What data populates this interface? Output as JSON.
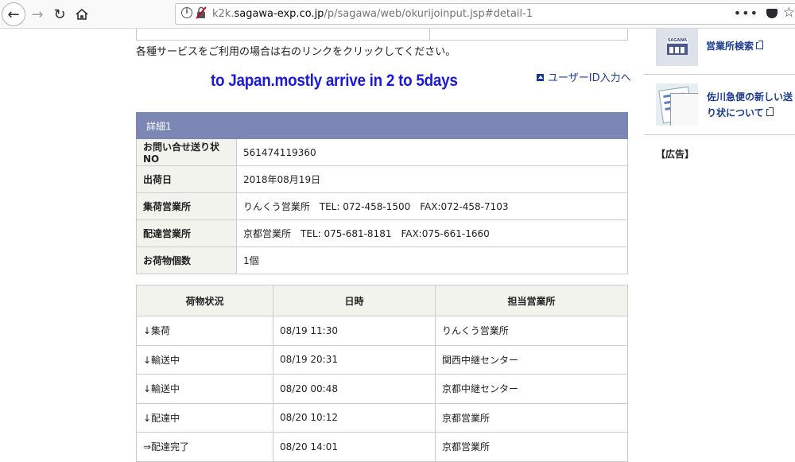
{
  "browser": {
    "url_prefix": "k2k.",
    "url_domain": "sagawa-exp.co.jp",
    "url_path": "/p/sagawa/web/okurijoinput.jsp#detail-1",
    "more": "•••"
  },
  "page": {
    "intro_text": "各種サービスをご利用の場合は右のリンクをクリックしてください。",
    "banner_text": "to Japan.mostly arrive in 2 to 5days",
    "userid_link": "ユーザーID入力へ"
  },
  "detail": {
    "header": "詳細1",
    "rows": [
      {
        "label": "お問い合せ送り状NO",
        "value": "561474119360"
      },
      {
        "label": "出荷日",
        "value": "2018年08月19日"
      },
      {
        "label": "集荷営業所",
        "value": "りんくう営業所　TEL: 072-458-1500　FAX:072-458-7103"
      },
      {
        "label": "配達営業所",
        "value": "京都営業所　TEL: 075-681-8181　FAX:075-661-1660"
      },
      {
        "label": "お荷物個数",
        "value": "1個"
      }
    ]
  },
  "status": {
    "columns": [
      "荷物状況",
      "日時",
      "担当営業所"
    ],
    "rows": [
      {
        "state": "↓集荷",
        "time": "08/19 11:30",
        "office": "りんくう営業所"
      },
      {
        "state": "↓輸送中",
        "time": "08/19 20:31",
        "office": "関西中継センター"
      },
      {
        "state": "↓輸送中",
        "time": "08/20 00:48",
        "office": "京都中継センター"
      },
      {
        "state": "↓配達中",
        "time": "08/20 10:12",
        "office": "京都営業所"
      },
      {
        "state": "⇒配達完了",
        "time": "08/20 14:01",
        "office": "京都営業所"
      }
    ]
  },
  "sidebar": {
    "office_search": "営業所検索",
    "office_icon_text": "SAGAWA",
    "new_slip": "佐川急便の新しい送り状について",
    "ad_label": "【広告】"
  }
}
